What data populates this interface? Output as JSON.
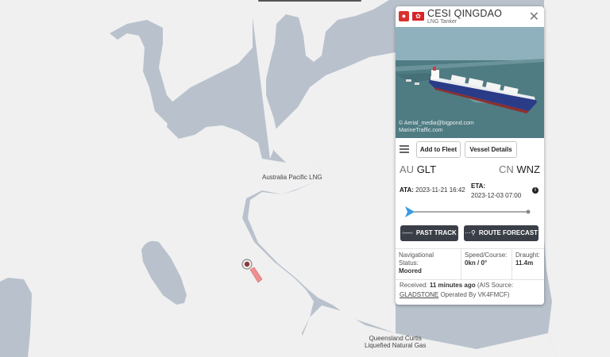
{
  "map": {
    "labels": {
      "australia_pacific_lng": "Australia Pacific LNG",
      "queensland_curtis": [
        "Queensland Curtis",
        "Liquefied Natural Gas"
      ]
    },
    "colors": {
      "land": "#f0f0f1",
      "water": "#b9c2cc",
      "vessel_marker": "#ef8f8f"
    }
  },
  "vessel": {
    "name": "CESI QINGDAO",
    "type": "LNG Tanker",
    "type_icon": "tanker-icon",
    "flag_icon": "hong-kong-flag-icon",
    "photo_credit": [
      "© Aerial_media@bigpond.com",
      "MarineTraffic.com"
    ],
    "buttons": {
      "add_to_fleet": "Add to Fleet",
      "vessel_details": "Vessel Details"
    },
    "departure": {
      "country": "AU",
      "port": "GLT"
    },
    "destination": {
      "country": "CN",
      "port": "WNZ"
    },
    "ata_label": "ATA:",
    "ata": "2023-11-21 16:42",
    "eta_label": "ETA:",
    "eta": "2023-12-03 07:00",
    "voyage_progress": 0,
    "actions": {
      "past_track": "PAST TRACK",
      "route_forecast": "ROUTE FORECAST"
    },
    "stats": {
      "nav_label": [
        "Navigational",
        "Status:"
      ],
      "nav_value": "Moored",
      "speed_label": "Speed/Course:",
      "speed_value": "0kn / 0°",
      "draught_label": "Draught:",
      "draught_value": "11.4m"
    },
    "received": {
      "label": "Received:",
      "age": "11 minutes ago",
      "source_prefix": "(AIS Source:",
      "source": "GLADSTONE",
      "operator": "Operated By VK4FMCF)"
    },
    "colors": {
      "accent_blue": "#3a9be0",
      "dark_button": "#3a3f47"
    }
  }
}
